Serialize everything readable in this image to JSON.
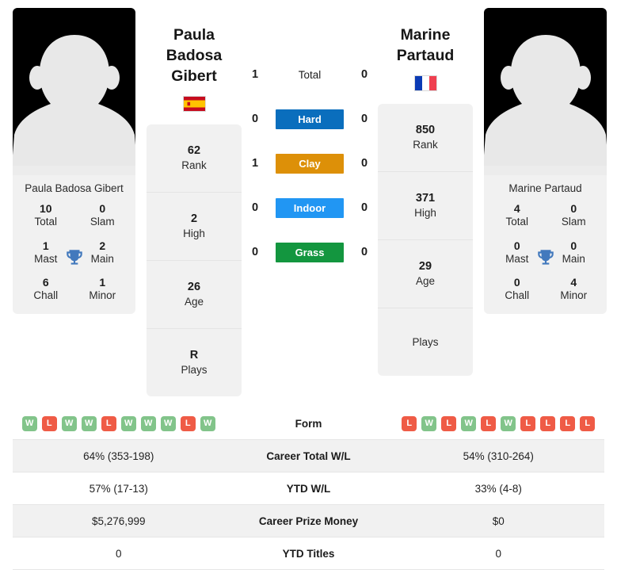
{
  "players": {
    "left": {
      "name_full": "Paula Badosa Gibert",
      "name_heading": "Paula Badosa\nGibert",
      "name_line1": "Paula Badosa",
      "name_line2": "Gibert",
      "country": "Spain",
      "flag_icon": "spain-flag-icon",
      "avatar_icon": "player-avatar-placeholder-icon",
      "info": [
        {
          "value": "62",
          "label": "Rank"
        },
        {
          "value": "2",
          "label": "High"
        },
        {
          "value": "26",
          "label": "Age"
        },
        {
          "value": "R",
          "label": "Plays"
        }
      ],
      "titles": [
        {
          "value": "10",
          "label": "Total"
        },
        {
          "value": "0",
          "label": "Slam"
        },
        {
          "value": "1",
          "label": "Mast"
        },
        {
          "value": "2",
          "label": "Main"
        },
        {
          "value": "6",
          "label": "Chall"
        },
        {
          "value": "1",
          "label": "Minor"
        }
      ],
      "form": [
        "W",
        "L",
        "W",
        "W",
        "L",
        "W",
        "W",
        "W",
        "L",
        "W"
      ],
      "career_total_wl": "64% (353-198)",
      "ytd_wl": "57% (17-13)",
      "career_prize_money": "$5,276,999",
      "ytd_titles": "0"
    },
    "right": {
      "name_full": "Marine Partaud",
      "name_line1": "Marine",
      "name_line2": "Partaud",
      "country": "France",
      "flag_icon": "france-flag-icon",
      "avatar_icon": "player-avatar-placeholder-icon",
      "info": [
        {
          "value": "850",
          "label": "Rank"
        },
        {
          "value": "371",
          "label": "High"
        },
        {
          "value": "29",
          "label": "Age"
        },
        {
          "value": "",
          "label": "Plays"
        }
      ],
      "titles": [
        {
          "value": "4",
          "label": "Total"
        },
        {
          "value": "0",
          "label": "Slam"
        },
        {
          "value": "0",
          "label": "Mast"
        },
        {
          "value": "0",
          "label": "Main"
        },
        {
          "value": "0",
          "label": "Chall"
        },
        {
          "value": "4",
          "label": "Minor"
        }
      ],
      "form": [
        "L",
        "W",
        "L",
        "W",
        "L",
        "W",
        "L",
        "L",
        "L",
        "L"
      ],
      "career_total_wl": "54% (310-264)",
      "ytd_wl": "33% (4-8)",
      "career_prize_money": "$0",
      "ytd_titles": "0"
    }
  },
  "head_to_head": [
    {
      "label": "Total",
      "left": "1",
      "right": "0",
      "color": "",
      "style": "plain"
    },
    {
      "label": "Hard",
      "left": "0",
      "right": "0",
      "color": "#0a6ebd",
      "style": "badge"
    },
    {
      "label": "Clay",
      "left": "1",
      "right": "0",
      "color": "#dd9008",
      "style": "badge"
    },
    {
      "label": "Indoor",
      "left": "0",
      "right": "0",
      "color": "#2196f3",
      "style": "badge"
    },
    {
      "label": "Grass",
      "left": "0",
      "right": "0",
      "color": "#13963f",
      "style": "badge"
    }
  ],
  "stat_rows": [
    {
      "label": "Form",
      "type": "form"
    },
    {
      "label": "Career Total W/L",
      "type": "text",
      "left": "64% (353-198)",
      "right": "54% (310-264)"
    },
    {
      "label": "YTD W/L",
      "type": "text",
      "left": "57% (17-13)",
      "right": "33% (4-8)"
    },
    {
      "label": "Career Prize Money",
      "type": "text",
      "left": "$5,276,999",
      "right": "$0"
    },
    {
      "label": "YTD Titles",
      "type": "text",
      "left": "0",
      "right": "0"
    }
  ],
  "colors": {
    "win_badge": "#82c48a",
    "loss_badge": "#ef5b46",
    "trophy": "#4279bd",
    "panel_bg": "#f1f1f1"
  }
}
